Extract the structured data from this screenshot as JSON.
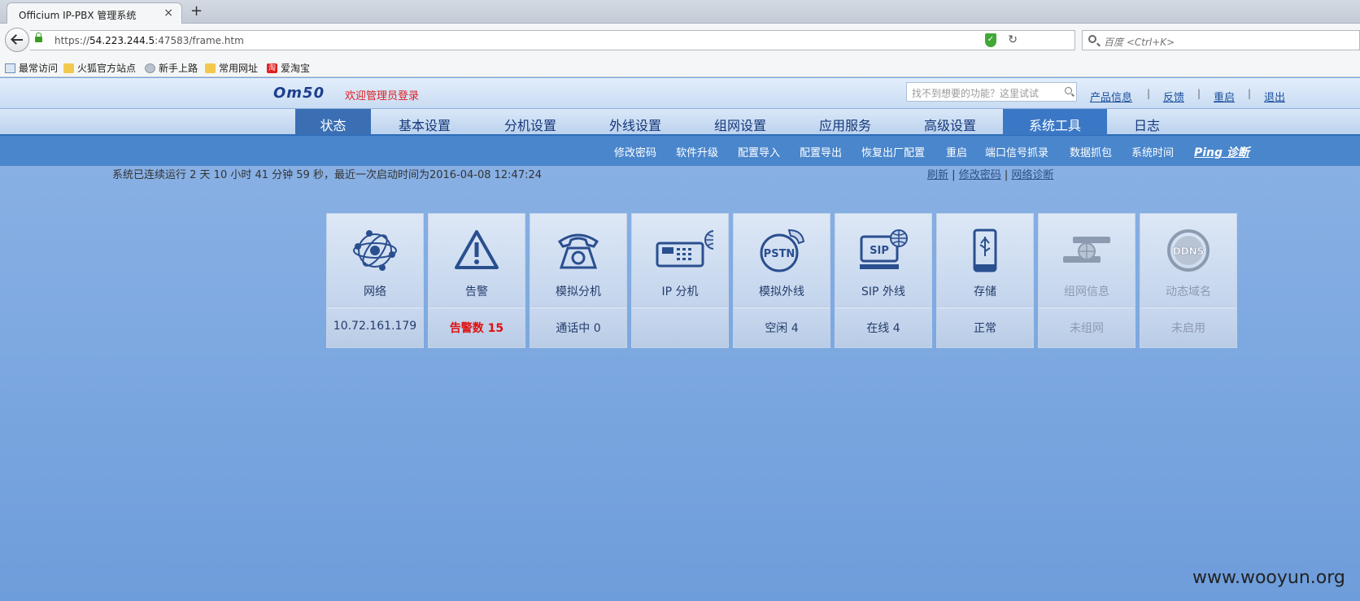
{
  "browser": {
    "tab_title": "Officium IP-PBX 管理系统",
    "new_tab": "+",
    "close": "×",
    "url_prefix": "https://",
    "url_host": "54.223.244.5",
    "url_rest": ":47583/frame.htm",
    "search_placeholder": "百度 <Ctrl+K>",
    "bookmarks": [
      "最常访问",
      "火狐官方站点",
      "新手上路",
      "常用网址",
      "爱淘宝"
    ],
    "taobao_glyph": "淘"
  },
  "header": {
    "logo": "Om50",
    "welcome": "欢迎管理员登录",
    "search_placeholder": "找不到想要的功能？这里试试",
    "links": [
      "产品信息",
      "反馈",
      "重启",
      "退出"
    ],
    "sep": "|"
  },
  "main_nav": {
    "items": [
      "状态",
      "基本设置",
      "分机设置",
      "外线设置",
      "组网设置",
      "应用服务",
      "高级设置",
      "系统工具",
      "日志"
    ],
    "active": "系统工具"
  },
  "sub_nav": {
    "items": [
      "修改密码",
      "软件升级",
      "配置导入",
      "配置导出",
      "恢复出厂配置",
      "重启",
      "端口信号抓录",
      "数据抓包",
      "系统时间",
      "Ping 诊断"
    ]
  },
  "status_bar": {
    "uptime": "系统已连续运行 2 天 10 小时 41 分钟 59 秒，最近一次启动时间为2016-04-08 12:47:24",
    "links": [
      "刷新",
      "修改密码",
      "网络诊断"
    ],
    "sep": "|"
  },
  "tiles": [
    {
      "label": "网络",
      "status": "10.72.161.179",
      "icon": "network-icon"
    },
    {
      "label": "告警",
      "status": "告警数 15",
      "icon": "warning-icon",
      "alarm": true
    },
    {
      "label": "模拟分机",
      "status": "通话中 0",
      "icon": "telephone-icon"
    },
    {
      "label": "IP 分机",
      "status": "",
      "icon": "ip-phone-icon"
    },
    {
      "label": "模拟外线",
      "status": "空闲 4",
      "icon": "pstn-icon"
    },
    {
      "label": "SIP 外线",
      "status": "在线 4",
      "icon": "sip-icon"
    },
    {
      "label": "存储",
      "status": "正常",
      "icon": "usb-storage-icon"
    },
    {
      "label": "组网信息",
      "status": "未组网",
      "icon": "networking-info-icon",
      "disabled": true
    },
    {
      "label": "动态域名",
      "status": "未启用",
      "icon": "ddns-icon",
      "disabled": true
    }
  ],
  "icon_text": {
    "pstn": "PSTN",
    "sip": "SIP",
    "ddns": "DDNS"
  },
  "colors": {
    "accent": "#3a78c6",
    "alarm": "#e01010",
    "page_bg": "#77a4dc"
  },
  "watermark": "www.wooyun.org"
}
